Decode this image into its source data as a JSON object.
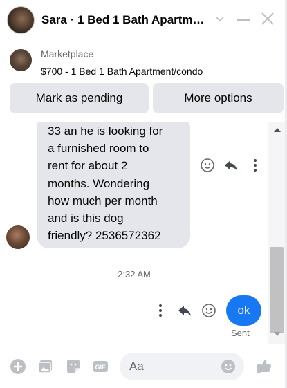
{
  "header": {
    "title": "Sara · 1 Bed 1 Bath Apartm…"
  },
  "listing": {
    "source": "Marketplace",
    "title": "$700 - 1 Bed 1 Bath Apartment/condo",
    "buttons": {
      "pending": "Mark as pending",
      "options": "More options"
    }
  },
  "thread": {
    "incoming_message": "33 an he is looking for\na furnished room to\nrent for about 2\nmonths. Wondering\nhow much per month\nand is this dog\nfriendly? 2536572362",
    "timestamp": "2:32 AM",
    "outgoing_message": "ok",
    "outgoing_status": "Sent"
  },
  "composer": {
    "placeholder": "Aa"
  },
  "colors": {
    "accent": "#1877f2",
    "bubble_in": "#e4e6eb",
    "secondary_text": "#65676b"
  },
  "icons": [
    "chevron-down-icon",
    "minimize-icon",
    "close-icon",
    "emoji-icon",
    "reply-icon",
    "more-icon",
    "plus-icon",
    "image-icon",
    "sticker-icon",
    "gif-icon",
    "like-icon"
  ]
}
